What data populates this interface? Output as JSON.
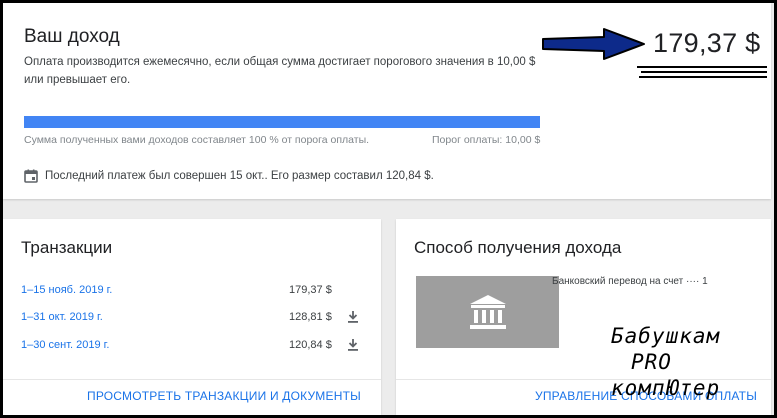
{
  "earnings": {
    "title": "Ваш доход",
    "description": "Оплата производится ежемесячно, если общая сумма достигает порогового значения в 10,00 $ или превышает его.",
    "amount": "179,37 $",
    "progress_fraction": 1.0,
    "progress_left_text": "Сумма полученных вами доходов составляет 100 % от порога оплаты.",
    "progress_right_text": "Порог оплаты: 10,00 $",
    "last_payment_text": "Последний платеж был совершен 15 окт.. Его размер составил 120,84 $.",
    "accent_color": "#4285f4"
  },
  "transactions": {
    "title": "Транзакции",
    "rows": [
      {
        "date": "1–15 нояб. 2019 г.",
        "amount": "179,37 $",
        "download": false
      },
      {
        "date": "1–31 окт. 2019 г.",
        "amount": "128,81 $",
        "download": true
      },
      {
        "date": "1–30 сент. 2019 г.",
        "amount": "120,84 $",
        "download": true
      }
    ],
    "action": "ПРОСМОТРЕТЬ ТРАНЗАКЦИИ И ДОКУМЕНТЫ",
    "link_color": "#1a73e8"
  },
  "payment_method": {
    "title": "Способ получения дохода",
    "method_text": "Банковский перевод на счет ···· 1",
    "icon": "bank-icon",
    "action": "УПРАВЛЕНИЕ СПОСОБАМИ ОПЛАТЫ"
  },
  "watermark": {
    "line1": "Бабушкам",
    "line2": "PRO",
    "line3": "компЮтер"
  }
}
